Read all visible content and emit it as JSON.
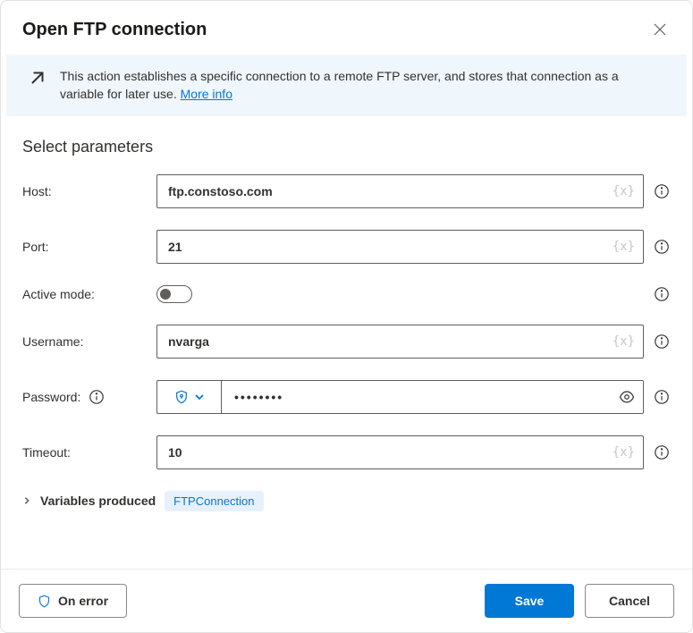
{
  "header": {
    "title": "Open FTP connection"
  },
  "banner": {
    "text": "This action establishes a specific connection to a remote FTP server, and stores that connection as a variable for later use. ",
    "link_text": "More info"
  },
  "section": {
    "title": "Select parameters"
  },
  "fields": {
    "host": {
      "label": "Host:",
      "value": "ftp.constoso.com"
    },
    "port": {
      "label": "Port:",
      "value": "21"
    },
    "active_mode": {
      "label": "Active mode:"
    },
    "username": {
      "label": "Username:",
      "value": "nvarga"
    },
    "password": {
      "label": "Password:",
      "value": "••••••••"
    },
    "timeout": {
      "label": "Timeout:",
      "value": "10"
    }
  },
  "variables": {
    "label": "Variables produced",
    "chip": "FTPConnection"
  },
  "footer": {
    "on_error": "On error",
    "save": "Save",
    "cancel": "Cancel"
  },
  "var_badge": "{x}"
}
